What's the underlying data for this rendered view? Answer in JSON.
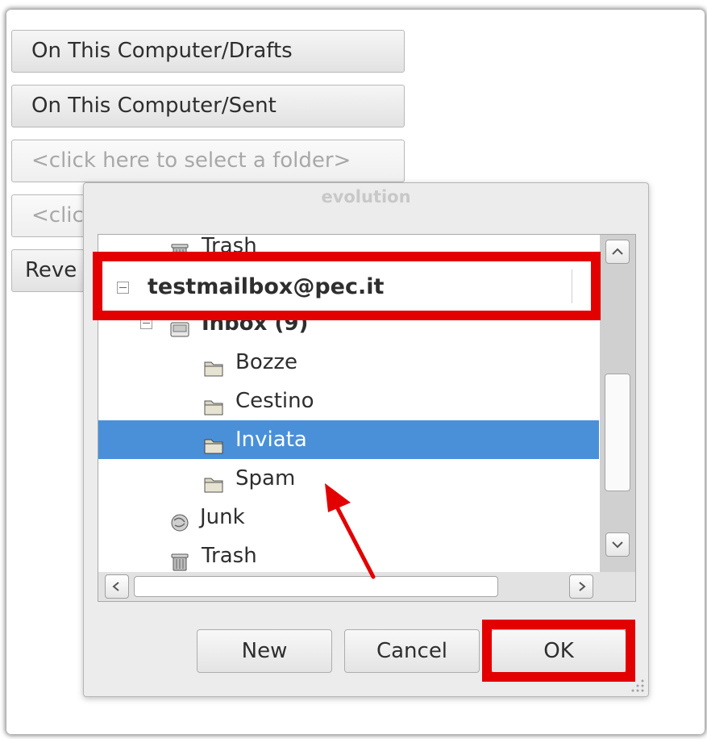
{
  "background_window": {
    "folder_buttons": [
      "On This Computer/Drafts",
      "On This Computer/Sent",
      "<click here to select a folder>",
      "<clic"
    ],
    "revert_label": "Reve"
  },
  "dialog": {
    "title": "evolution",
    "tree": {
      "items": [
        {
          "label": "Trash",
          "icon": "trash-icon"
        },
        {
          "label": "testmailbox@pec.it",
          "icon": "none"
        },
        {
          "label": "Inbox (9)",
          "icon": "inbox-icon"
        },
        {
          "label": "Bozze",
          "icon": "folder-icon"
        },
        {
          "label": "Cestino",
          "icon": "folder-icon"
        },
        {
          "label": "Inviata",
          "icon": "folder-icon",
          "selected": true
        },
        {
          "label": "Spam",
          "icon": "folder-icon"
        },
        {
          "label": "Junk",
          "icon": "junk-icon"
        },
        {
          "label": "Trash",
          "icon": "trash-icon"
        }
      ]
    },
    "buttons": {
      "new": "New",
      "cancel": "Cancel",
      "ok": "OK"
    }
  },
  "annotation": {
    "highlighted_account": "testmailbox@pec.it",
    "color": "#e30000"
  },
  "colors": {
    "selection": "#4a90d9",
    "annotation_red": "#e30000"
  }
}
